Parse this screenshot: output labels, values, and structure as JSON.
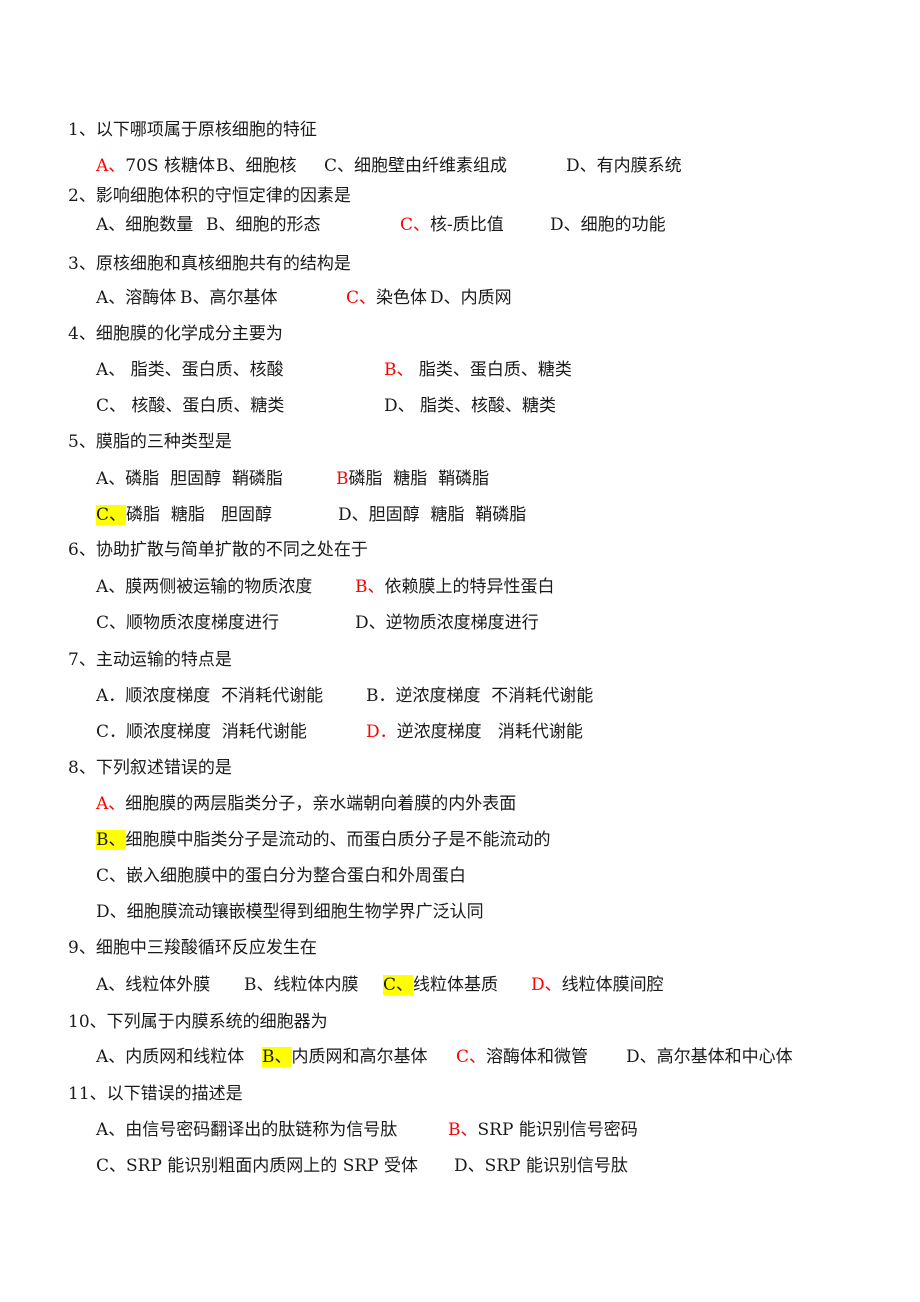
{
  "document": {
    "colors": {
      "answer_red": "#ff0000",
      "highlight_yellow": "#ffff00",
      "text": "#1a1a1a"
    },
    "questions": [
      {
        "title": "1、以下哪项属于原核细胞的特征",
        "rows": [
          [
            {
              "label": "A、",
              "text": "70S 核糖体",
              "style": "red"
            },
            {
              "label": "B、",
              "text": "细胞核",
              "style": ""
            },
            {
              "label": "C、",
              "text": "细胞壁由纤维素组成",
              "style": ""
            },
            {
              "label": "D、",
              "text": "有内膜系统",
              "style": ""
            }
          ]
        ]
      },
      {
        "title": "2、影响细胞体积的守恒定律的因素是",
        "rows": [
          [
            {
              "label": "A、",
              "text": "细胞数量",
              "style": ""
            },
            {
              "label": "B、",
              "text": "细胞的形态",
              "style": ""
            },
            {
              "label": "C、",
              "text": "核-质比值",
              "style": "red"
            },
            {
              "label": "D、",
              "text": "细胞的功能",
              "style": ""
            }
          ]
        ]
      },
      {
        "title": "3、原核细胞和真核细胞共有的结构是",
        "rows": [
          [
            {
              "label": "A、",
              "text": "溶酶体",
              "style": ""
            },
            {
              "label": "B、",
              "text": "高尔基体",
              "style": ""
            },
            {
              "label": "C、",
              "text": "染色体",
              "style": "red"
            },
            {
              "label": "D、",
              "text": "内质网",
              "style": ""
            }
          ]
        ]
      },
      {
        "title": "4、细胞膜的化学成分主要为",
        "rows": [
          [
            {
              "label": "A、",
              "text": " 脂类、蛋白质、核酸",
              "style": ""
            },
            {
              "label": "B、",
              "text": " 脂类、蛋白质、糖类",
              "style": "red"
            }
          ],
          [
            {
              "label": "C、",
              "text": " 核酸、蛋白质、糖类",
              "style": ""
            },
            {
              "label": "D、",
              "text": " 脂类、核酸、糖类",
              "style": ""
            }
          ]
        ]
      },
      {
        "title": "5、膜脂的三种类型是",
        "rows": [
          [
            {
              "label": "A、",
              "text": "磷脂  胆固醇  鞘磷脂",
              "style": ""
            },
            {
              "label": "B",
              "text": "磷脂  糖脂  鞘磷脂",
              "style": "red"
            }
          ],
          [
            {
              "label": "C、",
              "text": "磷脂  糖脂   胆固醇",
              "style": "hl"
            },
            {
              "label": "D、",
              "text": "胆固醇  糖脂  鞘磷脂",
              "style": ""
            }
          ]
        ]
      },
      {
        "title": "6、协助扩散与简单扩散的不同之处在于",
        "rows": [
          [
            {
              "label": "A、",
              "text": "膜两侧被运输的物质浓度",
              "style": ""
            },
            {
              "label": "B、",
              "text": "依赖膜上的特异性蛋白",
              "style": "red"
            }
          ],
          [
            {
              "label": "C、",
              "text": "顺物质浓度梯度进行",
              "style": ""
            },
            {
              "label": "D、",
              "text": "逆物质浓度梯度进行",
              "style": ""
            }
          ]
        ]
      },
      {
        "title": "7、主动运输的特点是",
        "rows": [
          [
            {
              "label": "A．",
              "text": "顺浓度梯度  不消耗代谢能",
              "style": ""
            },
            {
              "label": "B．",
              "text": "逆浓度梯度  不消耗代谢能",
              "style": ""
            }
          ],
          [
            {
              "label": "C．",
              "text": "顺浓度梯度  消耗代谢能",
              "style": ""
            },
            {
              "label": "D．",
              "text": "逆浓度梯度   消耗代谢能",
              "style": "red"
            }
          ]
        ]
      },
      {
        "title": "8、下列叙述错误的是",
        "rows": [
          [
            {
              "label": "A、",
              "text": "细胞膜的两层脂类分子，亲水端朝向着膜的内外表面",
              "style": "red"
            }
          ],
          [
            {
              "label": "B、",
              "text": "细胞膜中脂类分子是流动的、而蛋白质分子是不能流动的",
              "style": "hl"
            }
          ],
          [
            {
              "label": "C、",
              "text": "嵌入细胞膜中的蛋白分为整合蛋白和外周蛋白",
              "style": ""
            }
          ],
          [
            {
              "label": "D、",
              "text": "细胞膜流动镶嵌模型得到细胞生物学界广泛认同",
              "style": ""
            }
          ]
        ]
      },
      {
        "title": "9、细胞中三羧酸循环反应发生在",
        "rows": [
          [
            {
              "label": "A、",
              "text": "线粒体外膜",
              "style": ""
            },
            {
              "label": "B、",
              "text": "线粒体内膜",
              "style": ""
            },
            {
              "label": "C、",
              "text": "线粒体基质",
              "style": "hl"
            },
            {
              "label": "D、",
              "text": "线粒体膜间腔",
              "style": "red"
            }
          ]
        ]
      },
      {
        "title": "10、下列属于内膜系统的细胞器为",
        "rows": [
          [
            {
              "label": "A、",
              "text": "内质网和线粒体",
              "style": ""
            },
            {
              "label": "B、",
              "text": "内质网和高尔基体",
              "style": "hl"
            },
            {
              "label": "C、",
              "text": "溶酶体和微管",
              "style": "red"
            },
            {
              "label": "D、",
              "text": "高尔基体和中心体",
              "style": ""
            }
          ]
        ]
      },
      {
        "title": "11、以下错误的描述是",
        "rows": [
          [
            {
              "label": "A、",
              "text": "由信号密码翻译出的肽链称为信号肽",
              "style": ""
            },
            {
              "label": "B、",
              "text": "SRP 能识别信号密码",
              "style": "red"
            }
          ],
          [
            {
              "label": "C、",
              "text": "SRP 能识别粗面内质网上的 SRP 受体",
              "style": ""
            },
            {
              "label": "D、",
              "text": "SRP 能识别信号肽",
              "style": ""
            }
          ]
        ]
      }
    ]
  }
}
